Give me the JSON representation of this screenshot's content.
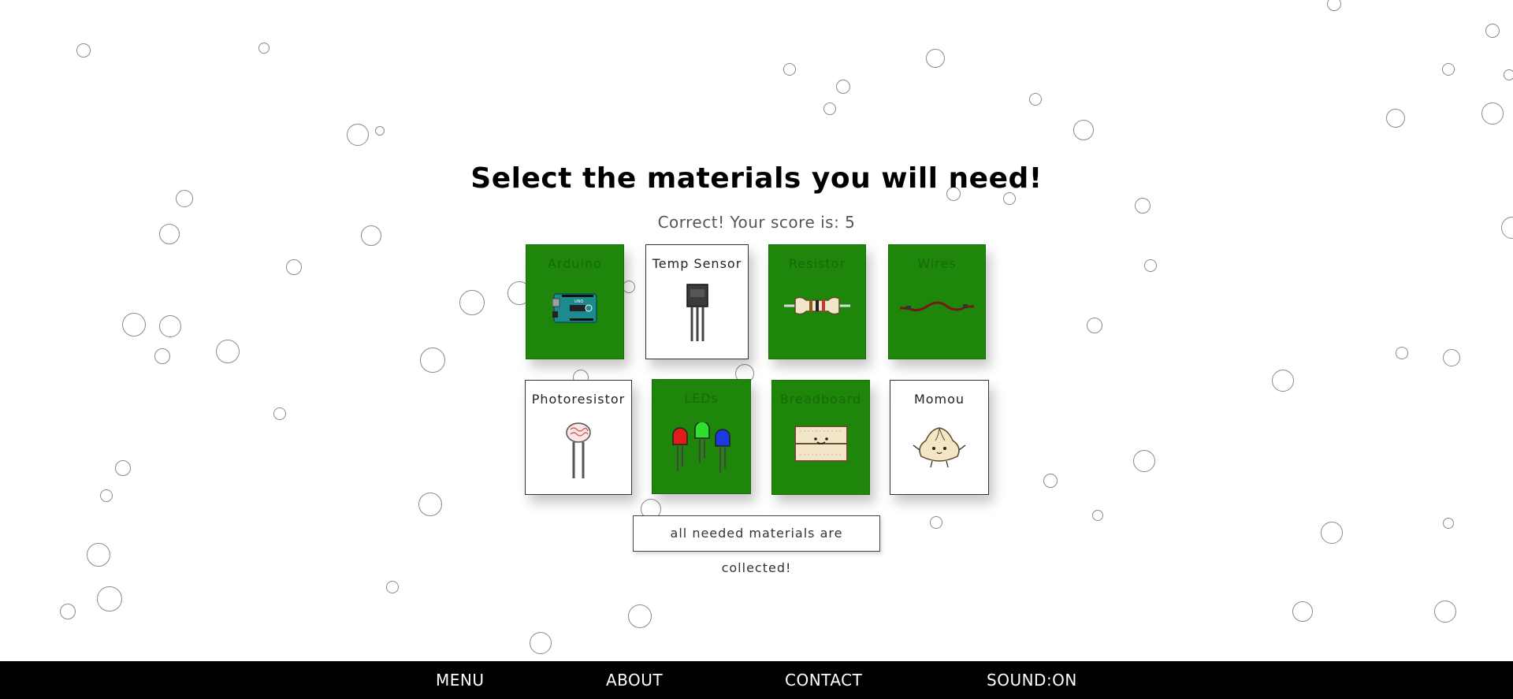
{
  "page": {
    "title": "Select the materials you will need!",
    "score_text": "Correct! Your score is: 5",
    "status_message": "all needed materials are collected!"
  },
  "materials": [
    {
      "label": "Arduino",
      "selected": true,
      "icon": "arduino-board-icon"
    },
    {
      "label": "Temp Sensor",
      "selected": false,
      "icon": "temp-sensor-icon"
    },
    {
      "label": "Resistor",
      "selected": true,
      "icon": "resistor-icon"
    },
    {
      "label": "Wires",
      "selected": true,
      "icon": "wire-icon"
    },
    {
      "label": "Photoresistor",
      "selected": false,
      "icon": "photoresistor-icon"
    },
    {
      "label": "LEDs",
      "selected": true,
      "icon": "leds-icon"
    },
    {
      "label": "Breadboard",
      "selected": true,
      "icon": "breadboard-icon"
    },
    {
      "label": "Momou",
      "selected": false,
      "icon": "momou-dumpling-icon"
    }
  ],
  "colors": {
    "selected_card": "#1e870b",
    "navbar_bg": "#000000",
    "navbar_text": "#ffffff"
  },
  "nav": {
    "menu": "MENU",
    "about": "ABOUT",
    "contact": "CONTACT",
    "sound": "SOUND:ON"
  }
}
